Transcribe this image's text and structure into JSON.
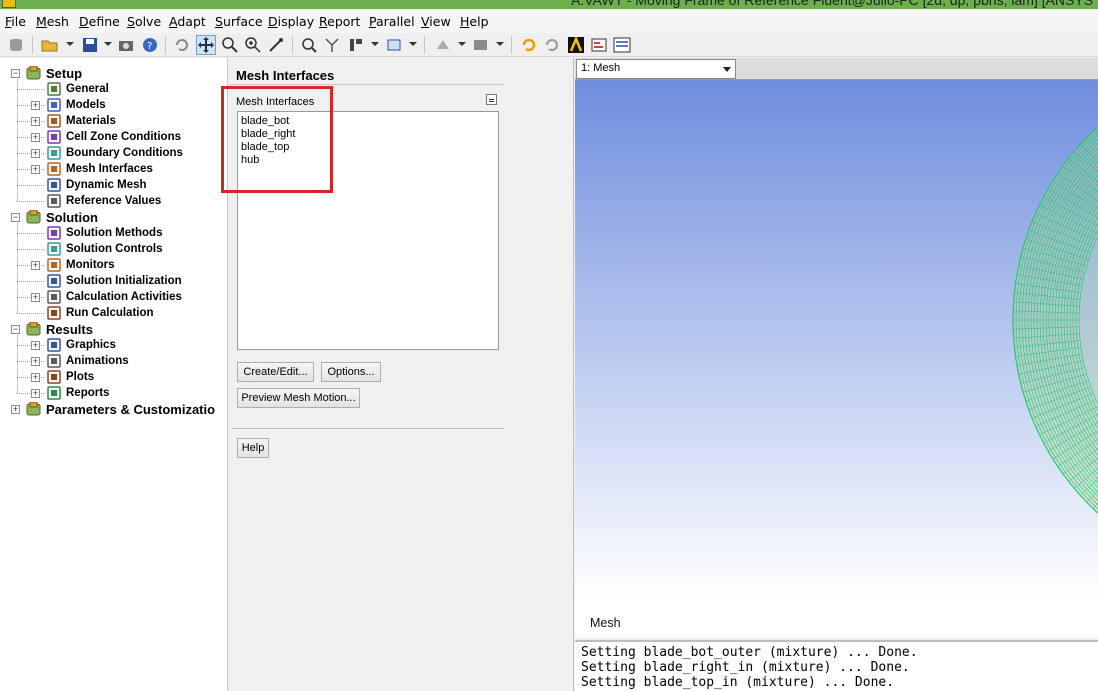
{
  "window": {
    "title": "A.VAWT - Moving Frame of Reference Fluent@Julio-PC  [2d, dp, pbns, lam] [ANSYS"
  },
  "menu": [
    {
      "label": "File"
    },
    {
      "label": "Mesh"
    },
    {
      "label": "Define"
    },
    {
      "label": "Solve"
    },
    {
      "label": "Adapt"
    },
    {
      "label": "Surface"
    },
    {
      "label": "Display"
    },
    {
      "label": "Report"
    },
    {
      "label": "Parallel"
    },
    {
      "label": "View"
    },
    {
      "label": "Help"
    }
  ],
  "toolbar": {
    "icons": [
      "stop-icon",
      "open-file-icon",
      "save-icon",
      "screenshot-icon",
      "help-context-icon",
      "rotate-icon",
      "pan-icon",
      "zoom-in-icon",
      "zoom-box-icon",
      "probe-icon",
      "fit-icon",
      "measure-icon",
      "views-icon",
      "display-box-icon",
      "rendering-icon",
      "lighting-icon",
      "refresh-icon",
      "sync-icon",
      "ansys-logo-icon",
      "journal-icon",
      "moe-icon"
    ],
    "active": "pan-icon"
  },
  "tree": {
    "sections": [
      {
        "label": "Setup",
        "items": [
          "General",
          "Models",
          "Materials",
          "Cell Zone Conditions",
          "Boundary Conditions",
          "Mesh Interfaces",
          "Dynamic Mesh",
          "Reference Values"
        ]
      },
      {
        "label": "Solution",
        "items": [
          "Solution Methods",
          "Solution Controls",
          "Monitors",
          "Solution Initialization",
          "Calculation Activities",
          "Run Calculation"
        ]
      },
      {
        "label": "Results",
        "items": [
          "Graphics",
          "Animations",
          "Plots",
          "Reports"
        ]
      },
      {
        "label": "Parameters & Customizatio",
        "items": []
      }
    ]
  },
  "task": {
    "title": "Mesh Interfaces",
    "list_caption": "Mesh Interfaces",
    "interfaces": [
      "blade_bot",
      "blade_right",
      "blade_top",
      "hub"
    ],
    "buttons": {
      "create_edit": "Create/Edit...",
      "options": "Options...",
      "preview": "Preview Mesh Motion...",
      "help": "Help"
    }
  },
  "graphics": {
    "view_selected": "1: Mesh",
    "caption": "Mesh",
    "background_top": "#6f8ede",
    "background_bottom": "#ffffff",
    "mesh_color": "#22c860"
  },
  "console": {
    "lines": [
      "Setting blade_bot_outer (mixture) ... Done.",
      "Setting blade_right_in (mixture) ... Done.",
      "Setting blade_top_in (mixture) ... Done."
    ]
  },
  "colors": {
    "highlight": "#dd2222",
    "title_bar": "#6ab04c"
  }
}
